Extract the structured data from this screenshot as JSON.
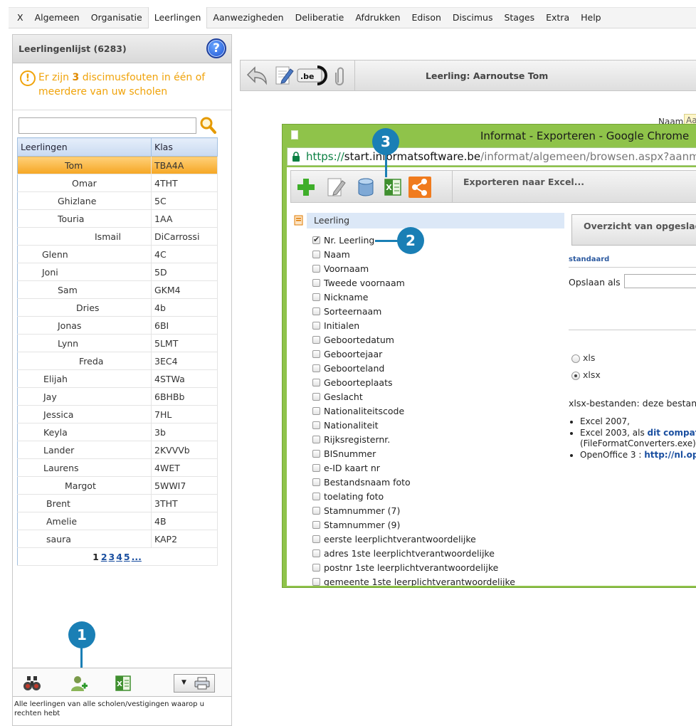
{
  "menu": {
    "items": [
      "X",
      "Algemeen",
      "Organisatie",
      "Leerlingen",
      "Aanwezigheden",
      "Deliberatie",
      "Afdrukken",
      "Edison",
      "Discimus",
      "Stages",
      "Extra",
      "Help"
    ],
    "active": "Leerlingen"
  },
  "left_panel": {
    "title": "Leerlingenlijst (6283)",
    "warning": {
      "prefix": "Er zijn ",
      "count": "3",
      "suffix": " discimusfouten in één of meerdere van uw scholen"
    },
    "search_value": "",
    "columns": [
      "Leerlingen",
      "Klas"
    ],
    "rows": [
      {
        "name": "Tom",
        "klas": "TBA4A",
        "indent": 66,
        "selected": true
      },
      {
        "name": "Omar",
        "klas": "4THT",
        "indent": 76
      },
      {
        "name": "Ghizlane",
        "klas": "5C",
        "indent": 56
      },
      {
        "name": "Touria",
        "klas": "1AA",
        "indent": 56
      },
      {
        "name": "Ismail",
        "klas": "DiCarrossi",
        "indent": 108
      },
      {
        "name": "Glenn",
        "klas": "4C",
        "indent": 34
      },
      {
        "name": "Joni",
        "klas": "5D",
        "indent": 34
      },
      {
        "name": "Sam",
        "klas": "GKM4",
        "indent": 56
      },
      {
        "name": "Dries",
        "klas": "4b",
        "indent": 82
      },
      {
        "name": "Jonas",
        "klas": "6BI",
        "indent": 56
      },
      {
        "name": "Lynn",
        "klas": "5LMT",
        "indent": 56
      },
      {
        "name": "Freda",
        "klas": "3EC4",
        "indent": 86
      },
      {
        "name": "Elijah",
        "klas": "4STWa",
        "indent": 36
      },
      {
        "name": "Jay",
        "klas": "6BHBb",
        "indent": 36
      },
      {
        "name": "Jessica",
        "klas": "7HL",
        "indent": 36
      },
      {
        "name": "Keyla",
        "klas": "3b",
        "indent": 36
      },
      {
        "name": "Lander",
        "klas": "2KVVVb",
        "indent": 36
      },
      {
        "name": "Laurens",
        "klas": "4WET",
        "indent": 36
      },
      {
        "name": "Margot",
        "klas": "5WWI7",
        "indent": 66
      },
      {
        "name": "Brent",
        "klas": "3THT",
        "indent": 40
      },
      {
        "name": "Amelie",
        "klas": "4B",
        "indent": 40
      },
      {
        "name": "saura",
        "klas": "KAP2",
        "indent": 40
      }
    ],
    "pager": {
      "current": "1",
      "pages": [
        "2",
        "3",
        "4",
        "5",
        "..."
      ]
    },
    "footnote": "Alle leerlingen van alle scholen/vestigingen waarop u rechten hebt"
  },
  "student_header": {
    "title": "Leerling: Aarnoutse Tom",
    "naam_label": "Naam",
    "naam_value": "Aa"
  },
  "popup": {
    "window_title": "Informat - Exporteren - Google Chrome",
    "url": {
      "scheme": "https://",
      "host": "start.informatsoftware.be",
      "path": "/informat/algemeen/browsen.aspx?aanmeldin"
    },
    "toolbar_title": "Exporteren naar Excel...",
    "section_title": "Leerling",
    "fields": [
      {
        "label": "Nr. Leerling",
        "checked": true
      },
      {
        "label": "Naam",
        "checked": false
      },
      {
        "label": "Voornaam",
        "checked": false
      },
      {
        "label": "Tweede voornaam",
        "checked": false
      },
      {
        "label": "Nickname",
        "checked": false
      },
      {
        "label": "Sorteernaam",
        "checked": false
      },
      {
        "label": "Initialen",
        "checked": false
      },
      {
        "label": "Geboortedatum",
        "checked": false
      },
      {
        "label": "Geboortejaar",
        "checked": false
      },
      {
        "label": "Geboorteland",
        "checked": false
      },
      {
        "label": "Geboorteplaats",
        "checked": false
      },
      {
        "label": "Geslacht",
        "checked": false
      },
      {
        "label": "Nationaliteitscode",
        "checked": false
      },
      {
        "label": "Nationaliteit",
        "checked": false
      },
      {
        "label": "Rijksregisternr.",
        "checked": false
      },
      {
        "label": "BISnummer",
        "checked": false
      },
      {
        "label": "e-ID kaart nr",
        "checked": false
      },
      {
        "label": "Bestandsnaam foto",
        "checked": false
      },
      {
        "label": "toelating foto",
        "checked": false
      },
      {
        "label": "Stamnummer (7)",
        "checked": false
      },
      {
        "label": "Stamnummer (9)",
        "checked": false
      },
      {
        "label": "eerste leerplichtverantwoordelijke",
        "checked": false
      },
      {
        "label": "adres 1ste leerplichtverantwoordelijke",
        "checked": false
      },
      {
        "label": "postnr 1ste leerplichtverantwoordelijke",
        "checked": false
      },
      {
        "label": "gemeente 1ste leerplichtverantwoordelijke",
        "checked": false
      }
    ],
    "saved_button": "Overzicht van opgeslagen",
    "standard_label": "standaard",
    "opslaan_label": "Opslaan als",
    "formats": [
      {
        "label": "xls",
        "selected": false
      },
      {
        "label": "xlsx",
        "selected": true
      }
    ],
    "xlsx_desc": "xlsx-bestanden: deze bestanden",
    "xlsx_list": {
      "item1": "Excel 2007,",
      "item2_prefix": "Excel 2003, als ",
      "item2_link": "dit compatib",
      "item2_line2": "(FileFormatConverters.exe)",
      "item3_prefix": "OpenOffice 3 : ",
      "item3_link": "http://nl.op"
    }
  },
  "badges": [
    "1",
    "2",
    "3"
  ],
  "icons": {
    "help": "help-icon",
    "warning": "warning-icon",
    "search": "search-icon",
    "binoculars": "binoculars-icon",
    "add_user": "add-user-icon",
    "excel": "excel-icon",
    "print": "print-icon",
    "undo": "undo-icon",
    "edit": "edit-icon",
    "eid": "eid-icon",
    "attach": "paperclip-icon",
    "add": "plus-icon",
    "database": "database-icon",
    "share": "share-icon"
  },
  "colors": {
    "accent": "#1a7fb5",
    "warning": "#f0a30a",
    "selected_row": "#f5a623",
    "popup_frame": "#8fc34a"
  }
}
